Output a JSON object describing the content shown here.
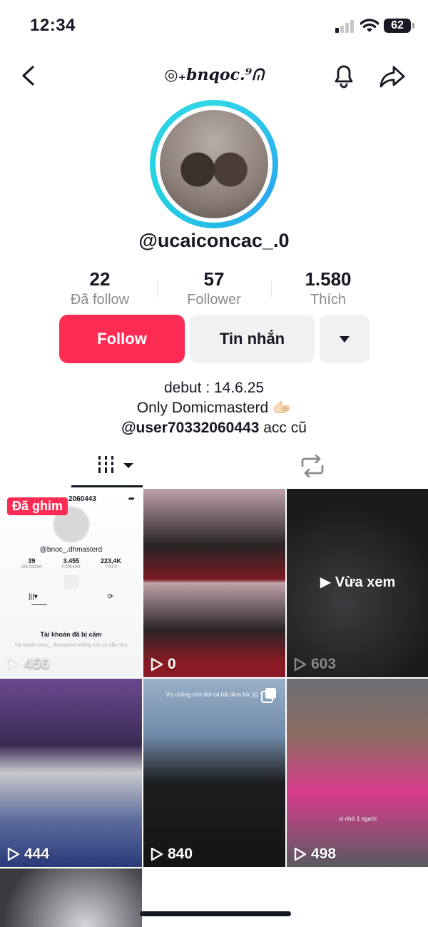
{
  "status_bar": {
    "time": "12:34",
    "battery": "62"
  },
  "header": {
    "title": "◎₊bnqoc.⁹ᕬ"
  },
  "profile": {
    "username": "@ucaiconcac_.0"
  },
  "stats": [
    {
      "value": "22",
      "label": "Đã follow"
    },
    {
      "value": "57",
      "label": "Follower"
    },
    {
      "value": "1.580",
      "label": "Thích"
    }
  ],
  "actions": {
    "follow": "Follow",
    "message": "Tin nhắn"
  },
  "bio": {
    "line1": "debut : 14.6.25",
    "line2": "Only Domicmasterd 🫱🏻",
    "mention": "@user70332060443",
    "line3_suffix": " acc cũ"
  },
  "videos": [
    {
      "views": "456",
      "badge": "Đã ghim",
      "mini": {
        "header": "2060443",
        "user": "@bnoc_.dhmasterd",
        "stats": [
          [
            "39",
            "Đã follow"
          ],
          [
            "3.455",
            "Follower"
          ],
          [
            "223,4K",
            "Thích"
          ]
        ],
        "banned": "Tài khoản đã bị cấm",
        "note": "Tài khoản bnoc_.dhmasterd không còn có sẵn nữa"
      }
    },
    {
      "views": "0"
    },
    {
      "views": "603",
      "overlay": "Vừa xem"
    },
    {
      "views": "444"
    },
    {
      "views": "840",
      "caption": "Vợ chồng chờ đợi cả hội đem hả :))) ?"
    },
    {
      "views": "498",
      "caption": "vì nhớ 1 người"
    },
    {
      "views": ""
    }
  ],
  "colors": {
    "accent": "#fe2c55",
    "text": "#161823",
    "muted": "#8a8b91",
    "ring": "#2fd6e8"
  },
  "icons": [
    "back-icon",
    "bell-icon",
    "share-icon",
    "grid-icon",
    "repost-icon",
    "play-icon"
  ]
}
